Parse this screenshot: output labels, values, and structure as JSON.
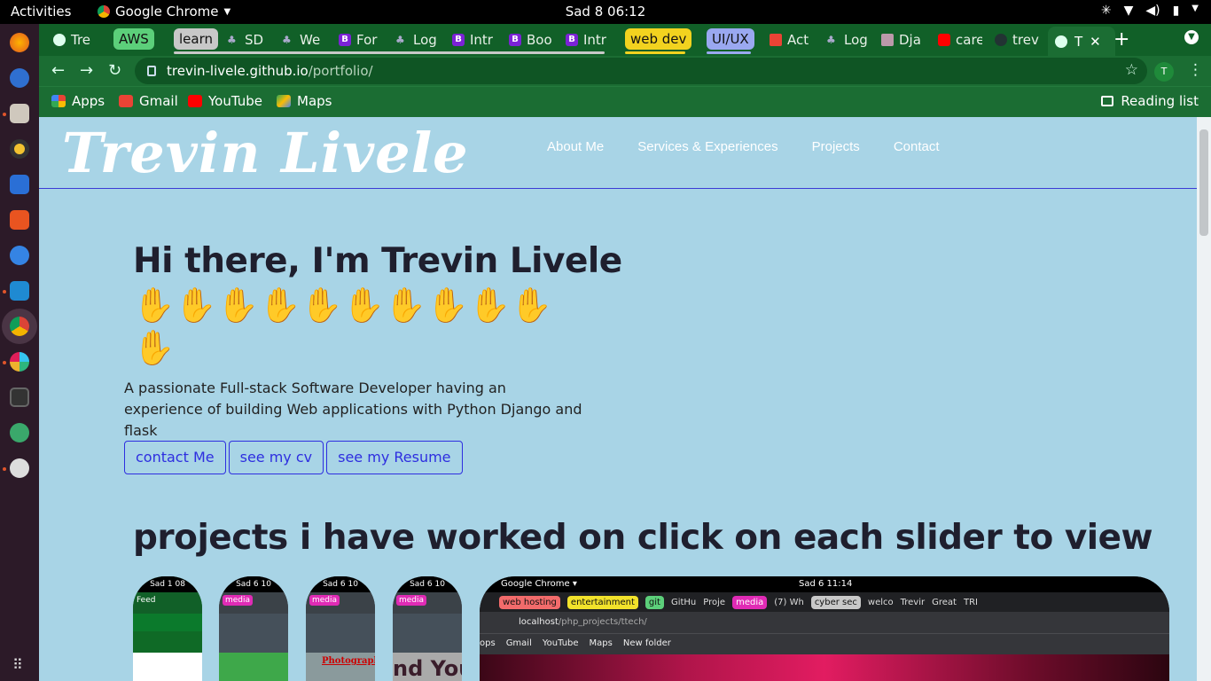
{
  "system": {
    "activities": "Activities",
    "app_name": "Google Chrome",
    "clock": "Sad 8  06:12"
  },
  "browser": {
    "tabs": [
      {
        "label": "Tre"
      },
      {
        "label": "SD"
      },
      {
        "label": "We"
      },
      {
        "label": "For"
      },
      {
        "label": "Log"
      },
      {
        "label": "Intr"
      },
      {
        "label": "Boo"
      },
      {
        "label": "Intr"
      },
      {
        "label": "Act"
      },
      {
        "label": "Log"
      },
      {
        "label": "Dja"
      },
      {
        "label": "care"
      },
      {
        "label": "trev"
      }
    ],
    "groups": [
      {
        "label": "AWS",
        "color": "#5ccf7a"
      },
      {
        "label": "learn",
        "color": "#c8c8c8"
      },
      {
        "label": "web dev",
        "color": "#f2d21f"
      },
      {
        "label": "UI/UX",
        "color": "#9aa8f0"
      }
    ],
    "active_tab": "T",
    "url_host": "trevin-livele.github.io",
    "url_path": "/portfolio/",
    "avatar": "T",
    "bookmarks": [
      {
        "label": "Apps",
        "icon": "apps-icon"
      },
      {
        "label": "Gmail",
        "icon": "gmail-icon"
      },
      {
        "label": "YouTube",
        "icon": "youtube-icon"
      },
      {
        "label": "Maps",
        "icon": "maps-icon"
      }
    ],
    "reading_list": "Reading list"
  },
  "site": {
    "logo": "Trevin Livele",
    "nav": [
      "About Me",
      "Services & Experiences",
      "Projects",
      "Contact"
    ],
    "hero_title": "Hi there, I'm Trevin Livele",
    "waves": "✋✋✋✋✋✋✋✋✋✋✋",
    "description": "A passionate Full-stack Software Developer having an experience of building Web applications with Python Django and flask",
    "buttons": [
      "contact Me",
      "see my cv",
      "see my Resume"
    ],
    "projects_title": "projects i have worked on click on each slider to view",
    "thumbs": [
      {
        "clock": "Sad 1  08",
        "tab": "Feed"
      },
      {
        "clock": "Sad 6  10",
        "tab": "media"
      },
      {
        "clock": "Sad 6  10",
        "tab": "media",
        "caption": "Photography"
      },
      {
        "clock": "Sad 6  10",
        "tab": "media",
        "caption": "nd You"
      }
    ],
    "big_shot": {
      "app": "Google Chrome ▾",
      "clock": "Sad 6  11:14",
      "tabs": [
        "web hosting",
        "entertainment",
        "git",
        "GitHu",
        "Proje",
        "media",
        "(7) Wh",
        "cyber sec",
        "welco",
        "Trevir",
        "Great",
        "TRI"
      ],
      "url_host": "localhost",
      "url_path": "/php_projects/ttech/",
      "bookmarks": [
        "ops",
        "Gmail",
        "YouTube",
        "Maps",
        "New folder"
      ]
    }
  }
}
